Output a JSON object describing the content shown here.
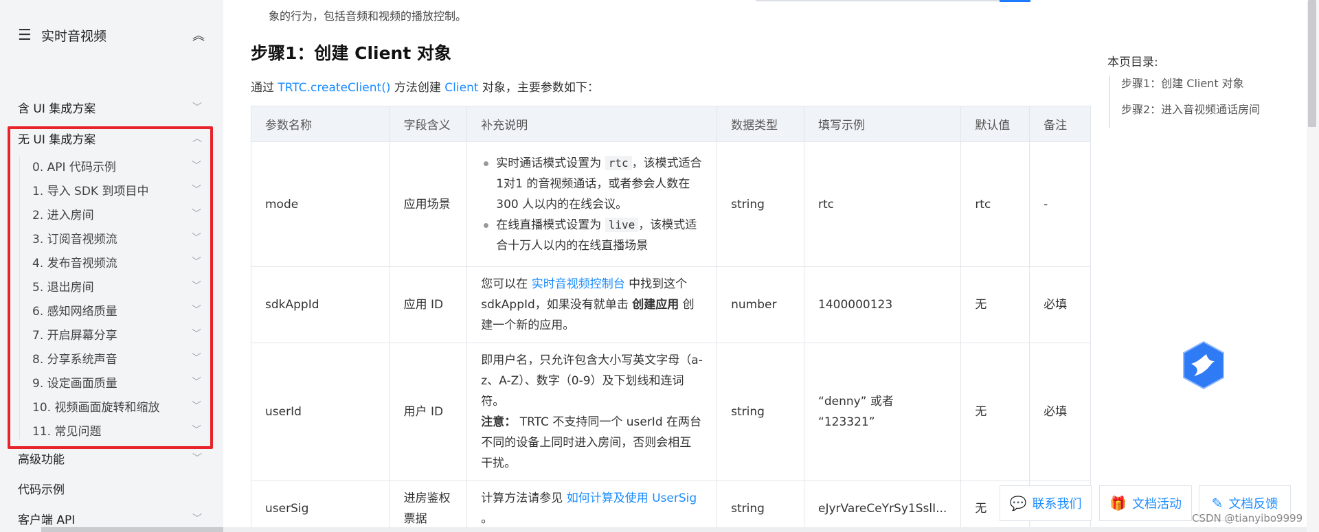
{
  "sidebar": {
    "title": "实时音视频",
    "items_top": [
      {
        "label": "含 UI 集成方案"
      },
      {
        "label": "无 UI 集成方案"
      }
    ],
    "sub_items": [
      {
        "label": "0. API 代码示例"
      },
      {
        "label": "1. 导入 SDK 到项目中"
      },
      {
        "label": "2. 进入房间"
      },
      {
        "label": "3. 订阅音视频流"
      },
      {
        "label": "4. 发布音视频流"
      },
      {
        "label": "5. 退出房间"
      },
      {
        "label": "6. 感知网络质量"
      },
      {
        "label": "7. 开启屏幕分享"
      },
      {
        "label": "8. 分享系统声音"
      },
      {
        "label": "9. 设定画面质量"
      },
      {
        "label": "10. 视频画面旋转和缩放"
      },
      {
        "label": "11. 常见问题"
      }
    ],
    "items_bottom": [
      {
        "label": "高级功能"
      },
      {
        "label": "代码示例"
      },
      {
        "label": "客户端 API"
      }
    ]
  },
  "main": {
    "top_cut_text": "象的行为，包括音频和视频的播放控制。",
    "heading": "步骤1：创建 Client 对象",
    "intro": {
      "prefix": "通过 ",
      "link1": "TRTC.createClient()",
      "mid": " 方法创建 ",
      "link2": "Client",
      "suffix": " 对象，主要参数如下："
    },
    "table": {
      "headers": [
        "参数名称",
        "字段含义",
        "补充说明",
        "数据类型",
        "填写示例",
        "默认值",
        "备注"
      ],
      "rows": [
        {
          "name": "mode",
          "meaning": "应用场景",
          "b1_pre": "实时通话模式设置为 ",
          "b1_code": "rtc",
          "b1_post": "，该模式适合 1对1 的音视频通话，或者参会人数在 300 人以内的在线会议。",
          "b2_pre": "在线直播模式设置为 ",
          "b2_code": "live",
          "b2_post": "，该模式适合十万人以内的在线直播场景",
          "type": "string",
          "example": "rtc",
          "default": "rtc",
          "note": "-"
        },
        {
          "name": "sdkAppId",
          "meaning": "应用 ID",
          "d_pre": "您可以在 ",
          "d_link": "实时音视频控制台",
          "d_mid": " 中找到这个 sdkAppId，如果没有就单击 ",
          "d_bold": "创建应用",
          "d_post": " 创建一个新的应用。",
          "type": "number",
          "example": "1400000123",
          "default": "无",
          "note": "必填"
        },
        {
          "name": "userId",
          "meaning": "用户 ID",
          "d_text": "即用户名，只允许包含大小写英文字母（a-z、A-Z）、数字（0-9）及下划线和连词符。",
          "d_bold": "注意：",
          "d_post": " TRTC 不支持同一个 userId 在两台不同的设备上同时进入房间，否则会相互干扰。",
          "type": "string",
          "example": "“denny” 或者 “123321”",
          "default": "无",
          "note": "必填"
        },
        {
          "name": "userSig",
          "meaning": "进房鉴权票据",
          "d_pre": "计算方法请参见 ",
          "d_link": "如何计算及使用 UserSig",
          "d_post": "。",
          "type": "string",
          "example": "eJyrVareCeYrSy1SslI...",
          "default": "无",
          "note": ""
        }
      ]
    }
  },
  "toc": {
    "title": "本页目录:",
    "items": [
      {
        "label": "步骤1：创建 Client 对象"
      },
      {
        "label": "步骤2：进入音视频通话房间"
      }
    ]
  },
  "float_buttons": [
    {
      "label": "联系我们",
      "icon": "chat-icon"
    },
    {
      "label": "文档活动",
      "icon": "gift-icon"
    },
    {
      "label": "文档反馈",
      "icon": "edit-icon"
    }
  ],
  "watermark": "CSDN @tianyibo9999",
  "colors": {
    "accent": "#1a8cff",
    "highlight": "#e8232b"
  }
}
